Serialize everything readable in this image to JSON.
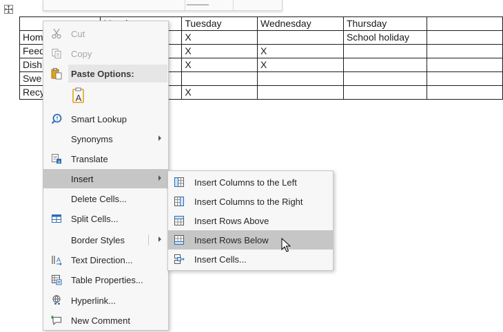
{
  "table": {
    "columns": [
      "",
      "Monday",
      "Tuesday",
      "Wednesday",
      "Thursday",
      ""
    ],
    "rows": [
      [
        "Hom",
        "",
        "X",
        "",
        "School holiday",
        ""
      ],
      [
        "Feed",
        "",
        "X",
        "X",
        "",
        ""
      ],
      [
        "Dish",
        "",
        "X",
        "X",
        "",
        ""
      ],
      [
        "Swe",
        "",
        "",
        "",
        "",
        ""
      ],
      [
        "Recy",
        "",
        "X",
        "",
        "",
        ""
      ]
    ]
  },
  "context_menu": {
    "cut": "Cut",
    "copy": "Copy",
    "paste_options": "Paste Options:",
    "smart_lookup": "Smart Lookup",
    "synonyms": "Synonyms",
    "translate": "Translate",
    "insert": "Insert",
    "delete_cells": "Delete Cells...",
    "split_cells": "Split Cells...",
    "border_styles": "Border Styles",
    "text_direction": "Text Direction...",
    "table_properties": "Table Properties...",
    "hyperlink": "Hyperlink...",
    "new_comment": "New Comment"
  },
  "insert_submenu": {
    "cols_left": "Insert Columns to the Left",
    "cols_right": "Insert Columns to the Right",
    "rows_above": "Insert Rows Above",
    "rows_below": "Insert Rows Below",
    "cells": "Insert Cells..."
  },
  "colors": {
    "menu_bg": "#f7f7f7",
    "highlight": "#c6c6c6",
    "icon_blue": "#2b6cb5",
    "paste_orange": "#e3a21a"
  }
}
